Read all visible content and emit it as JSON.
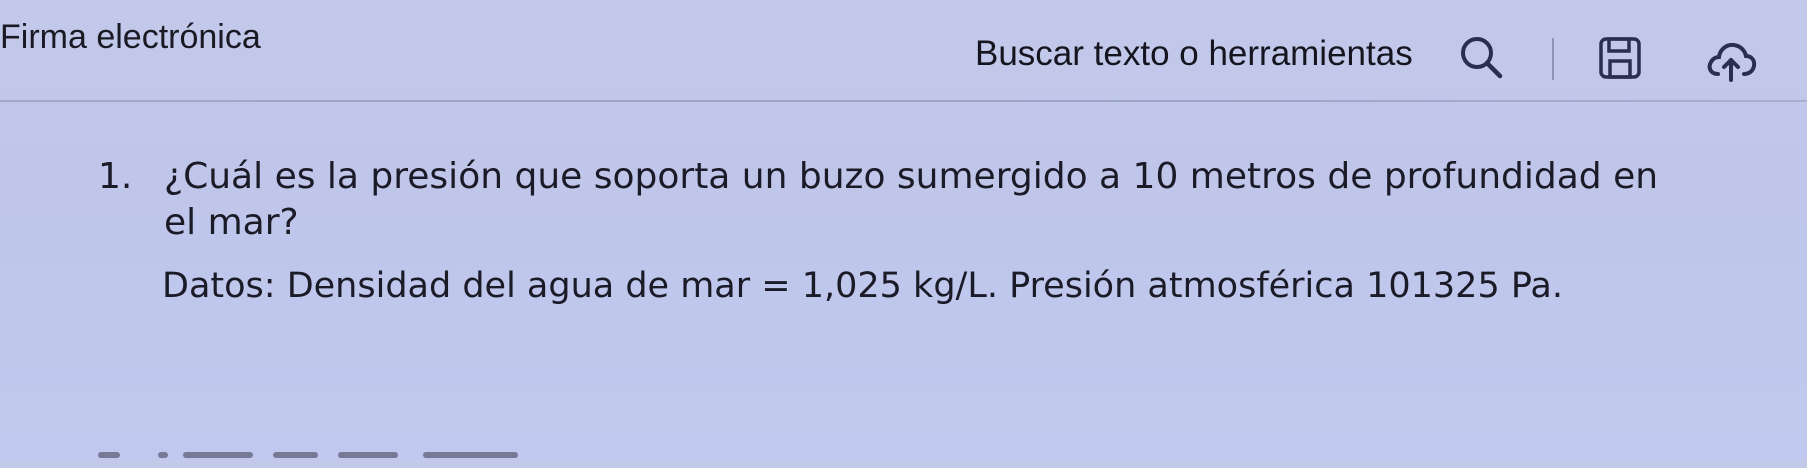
{
  "toolbar": {
    "app_label": "Firma electrónica",
    "search_label": "Buscar texto o herramientas",
    "icons": {
      "search": "search-icon",
      "save": "save-icon",
      "cloud_upload": "cloud-upload-icon"
    }
  },
  "document": {
    "question": {
      "number": "1.",
      "line1": "¿Cuál es la presión que soporta un buzo sumergido a 10 metros de profundidad en",
      "line2": "el mar?",
      "data": "Datos: Densidad del agua de mar = 1,025 kg/L. Presión atmosférica 101325 Pa."
    }
  },
  "colors": {
    "background": "#c1c8ec",
    "text": "#1b1b28",
    "divider": "#9ca3c4"
  }
}
